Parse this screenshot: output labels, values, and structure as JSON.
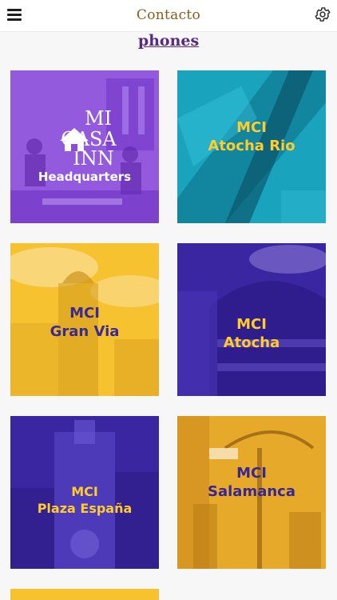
{
  "header": {
    "title": "Contacto",
    "menu_icon": "hamburger-icon",
    "settings_icon": "gear-icon"
  },
  "phones_link": "phones",
  "logo_text": [
    "MI",
    "CASA",
    "INN"
  ],
  "tiles": [
    {
      "lines": [
        "Headquarters"
      ],
      "color": "#8a4ddb",
      "text_color": "#ffffff"
    },
    {
      "lines": [
        "MCI",
        "Atocha Rio"
      ],
      "color": "#1aa3bd",
      "text_color": "#ffcc2e"
    },
    {
      "lines": [
        "MCI",
        "Gran Via"
      ],
      "color": "#f6c230",
      "text_color": "#3c2a8c"
    },
    {
      "lines": [
        "MCI",
        "Atocha"
      ],
      "color": "#3a26a0",
      "text_color": "#ffcc2e"
    },
    {
      "lines": [
        "MCI",
        "Plaza España"
      ],
      "color": "#3a26a0",
      "text_color": "#ffcc2e"
    },
    {
      "lines": [
        "MCI",
        "Salamanca"
      ],
      "color": "#e7a92a",
      "text_color": "#3a2690"
    }
  ]
}
